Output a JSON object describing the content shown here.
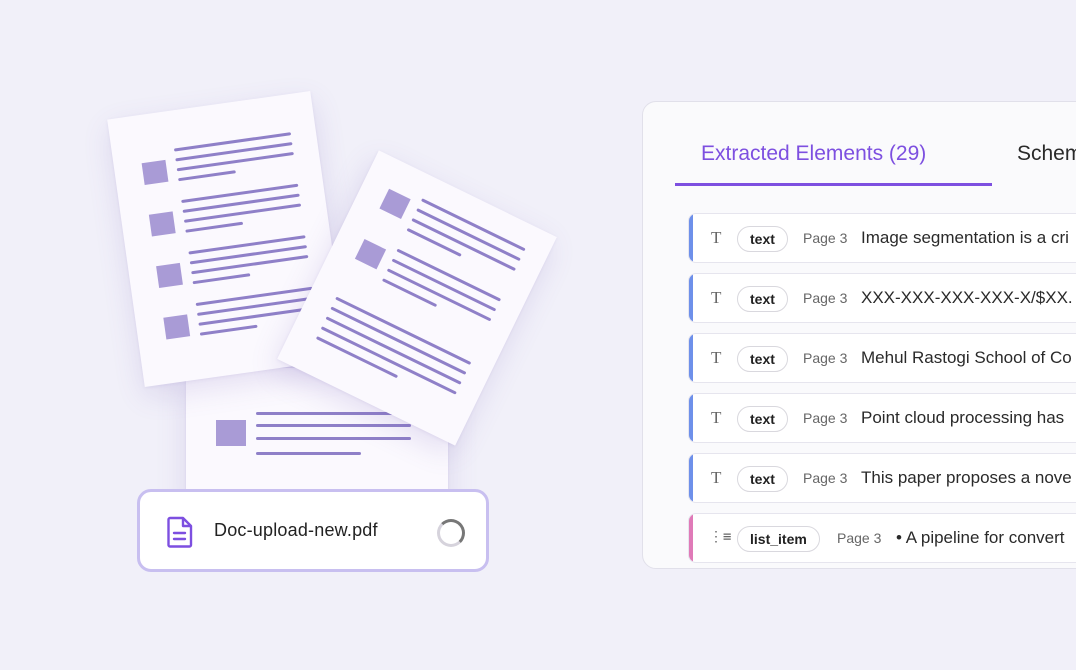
{
  "upload": {
    "file_name": "Doc-upload-new.pdf",
    "icon": "document-icon",
    "status": "loading"
  },
  "panel": {
    "tabs": [
      {
        "label": "Extracted Elements (29)",
        "active": true
      },
      {
        "label": "Schem",
        "active": false
      }
    ],
    "rows": [
      {
        "type": "text",
        "page": "Page 3",
        "snippet": "Image segmentation is a cri",
        "icon": "text-type-icon"
      },
      {
        "type": "text",
        "page": "Page 3",
        "snippet": "XXX-XXX-XXX-XXX-X/$XX.",
        "icon": "text-type-icon"
      },
      {
        "type": "text",
        "page": "Page 3",
        "snippet": "Mehul Rastogi School of Co",
        "icon": "text-type-icon"
      },
      {
        "type": "text",
        "page": "Page 3",
        "snippet": "Point cloud processing has",
        "icon": "text-type-icon"
      },
      {
        "type": "text",
        "page": "Page 3",
        "snippet": "This paper proposes a nove",
        "icon": "text-type-icon"
      },
      {
        "type": "list_item",
        "page": "Page 3",
        "snippet": "• A pipeline for convert",
        "icon": "list-item-icon"
      }
    ]
  },
  "colors": {
    "accent": "#7d4fe0",
    "text_bar": "#6e90ea",
    "list_bar": "#e07ab8",
    "background": "#f1f0f9"
  }
}
